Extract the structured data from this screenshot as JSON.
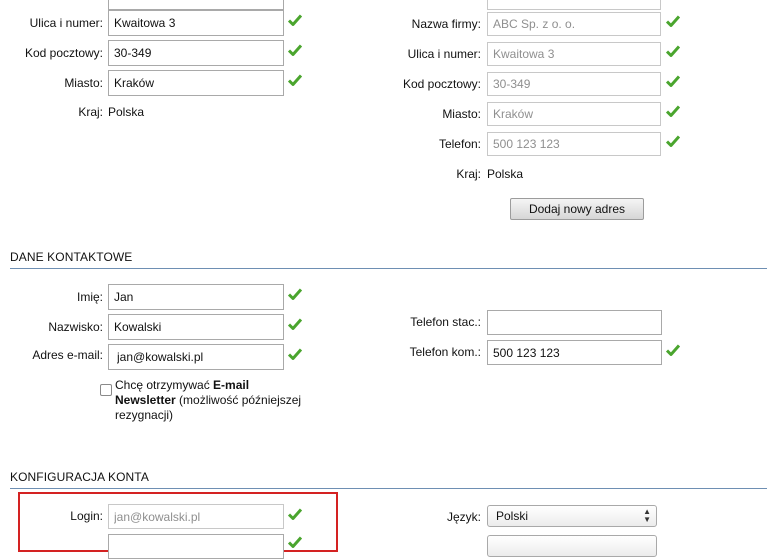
{
  "address_left": {
    "street_label": "Ulica i numer:",
    "street_value": "Kwaitowa 3",
    "postal_label": "Kod pocztowy:",
    "postal_value": "30-349",
    "city_label": "Miasto:",
    "city_value": "Kraków",
    "country_label": "Kraj:",
    "country_value": "Polska"
  },
  "address_right": {
    "company_label": "Nazwa firmy:",
    "company_value": "ABC Sp. z o. o.",
    "street_label": "Ulica i numer:",
    "street_value": "Kwaitowa 3",
    "postal_label": "Kod pocztowy:",
    "postal_value": "30-349",
    "city_label": "Miasto:",
    "city_value": "Kraków",
    "phone_label": "Telefon:",
    "phone_value": "500 123 123",
    "country_label": "Kraj:",
    "country_value": "Polska",
    "add_button_label": "Dodaj nowy adres"
  },
  "contact": {
    "section_title": "DANE KONTAKTOWE",
    "first_name_label": "Imię:",
    "first_name_value": "Jan",
    "last_name_label": "Nazwisko:",
    "last_name_value": "Kowalski",
    "email_label": "Adres e-mail:",
    "email_value": "jan@kowalski.pl",
    "landline_label": "Telefon stac.:",
    "landline_value": "",
    "mobile_label": "Telefon kom.:",
    "mobile_value": "500 123 123",
    "newsletter_prefix": "Chcę otrzymywać ",
    "newsletter_bold": "E-mail Newsletter",
    "newsletter_suffix": " (możliwość późniejszej rezygnacji)"
  },
  "account": {
    "section_title": "KONFIGURACJA KONTA",
    "login_label": "Login:",
    "login_value": "jan@kowalski.pl",
    "language_label": "Język:",
    "language_value": "Polski"
  },
  "colors": {
    "check_green": "#4aa52e",
    "section_rule": "#6e8fb3",
    "highlight_red": "#d42222"
  }
}
